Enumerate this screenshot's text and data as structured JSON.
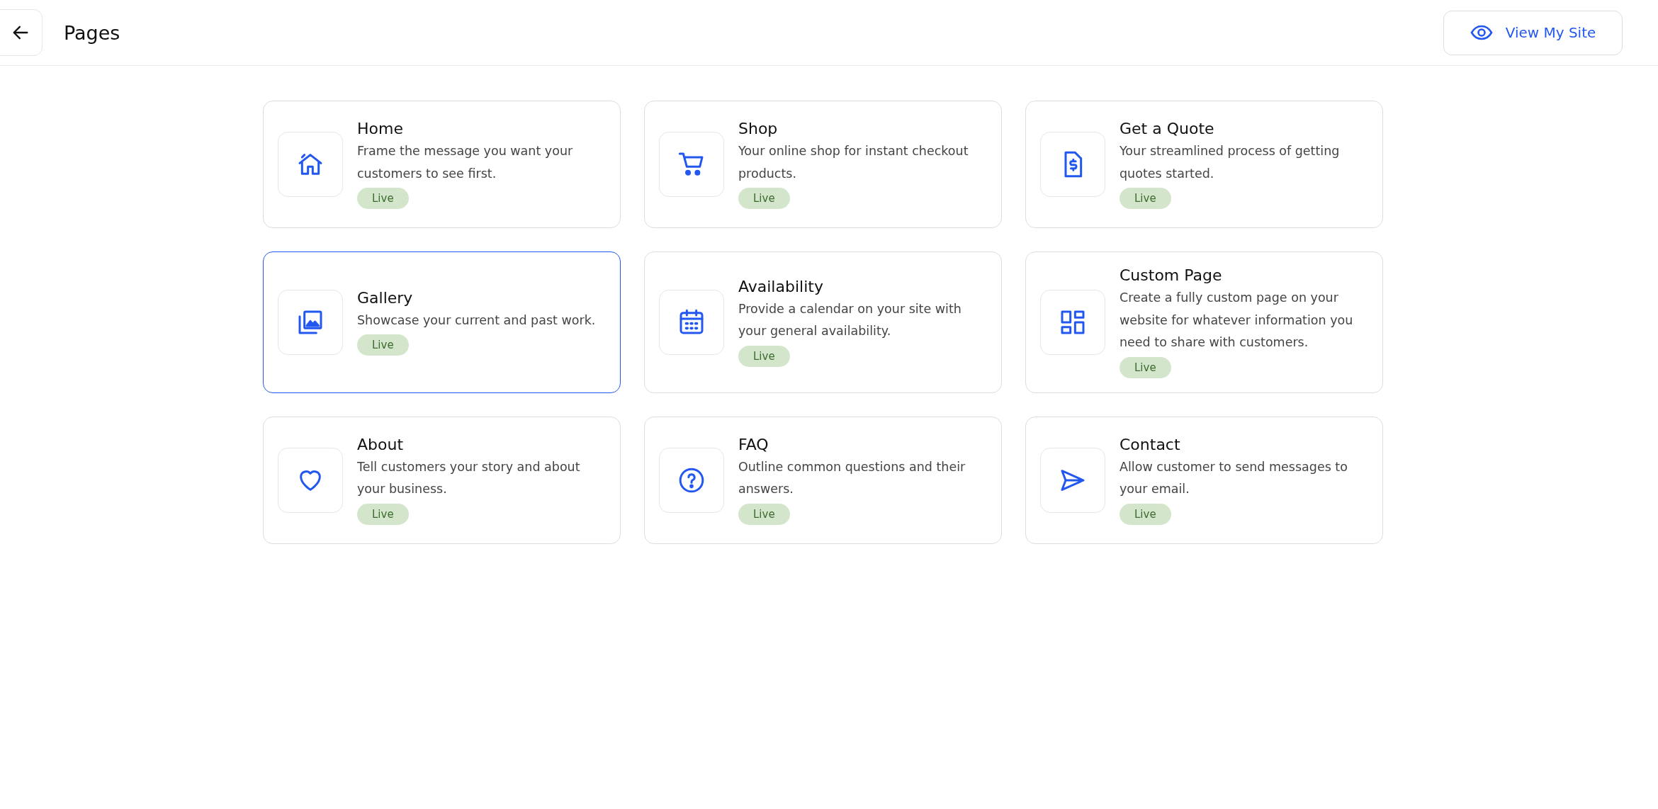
{
  "header": {
    "title": "Pages",
    "view_site_button": "View My Site"
  },
  "pages": [
    {
      "title": "Home",
      "description": "Frame the message you want your customers to see first.",
      "status": "Live",
      "selected": false
    },
    {
      "title": "Shop",
      "description": "Your online shop for instant checkout products.",
      "status": "Live",
      "selected": false
    },
    {
      "title": "Get a Quote",
      "description": "Your streamlined process of getting quotes started.",
      "status": "Live",
      "selected": false
    },
    {
      "title": "Gallery",
      "description": "Showcase your current and past work.",
      "status": "Live",
      "selected": true
    },
    {
      "title": "Availability",
      "description": "Provide a calendar on your site with your general availability.",
      "status": "Live",
      "selected": false
    },
    {
      "title": "Custom Page",
      "description": "Create a fully custom page on your website for whatever information you need to share with customers.",
      "status": "Live",
      "selected": false
    },
    {
      "title": "About",
      "description": "Tell customers your story and about your business.",
      "status": "Live",
      "selected": false
    },
    {
      "title": "FAQ",
      "description": "Outline common questions and their answers.",
      "status": "Live",
      "selected": false
    },
    {
      "title": "Contact",
      "description": "Allow customer to send messages to your email.",
      "status": "Live",
      "selected": false
    }
  ]
}
